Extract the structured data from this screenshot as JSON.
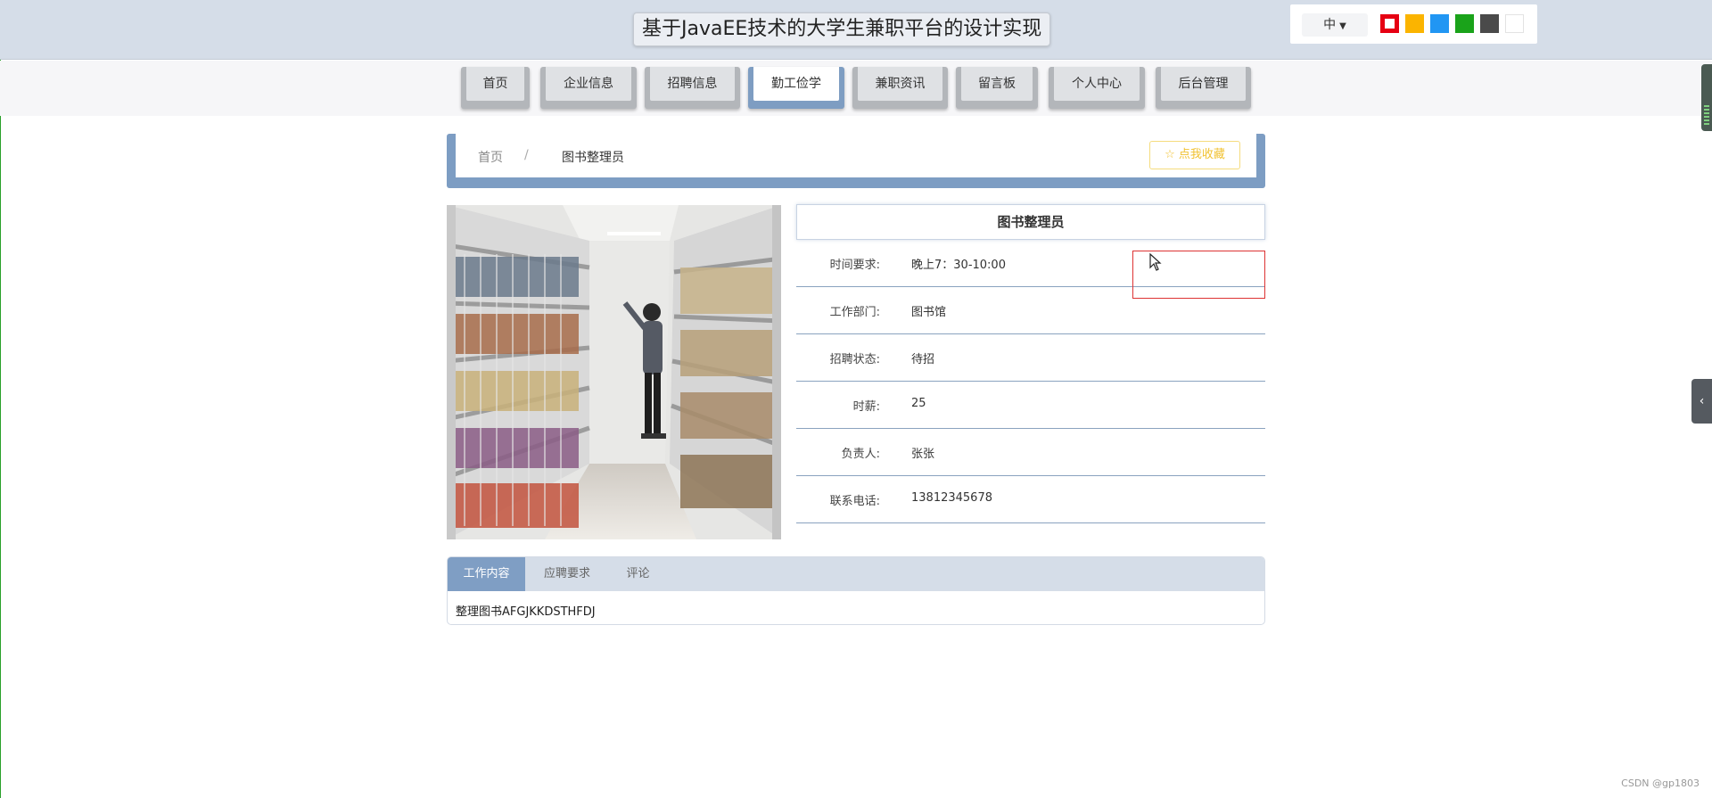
{
  "header": {
    "title": "基于JavaEE技术的大学生兼职平台的设计实现",
    "lang": "中",
    "theme_colors": [
      "#e60012",
      "#fbb400",
      "#2196f3",
      "#1aa31a",
      "#4a4a4a",
      "#ffffff"
    ]
  },
  "nav": [
    {
      "label": "首页"
    },
    {
      "label": "企业信息"
    },
    {
      "label": "招聘信息"
    },
    {
      "label": "勤工俭学"
    },
    {
      "label": "兼职资讯"
    },
    {
      "label": "留言板"
    },
    {
      "label": "个人中心"
    },
    {
      "label": "后台管理"
    }
  ],
  "nav_active": "勤工俭学",
  "breadcrumb": {
    "home": "首页",
    "separator": "/",
    "current": "图书整理员"
  },
  "favorite": {
    "icon": "star-outline-icon",
    "label": "点我收藏"
  },
  "detail": {
    "title": "图书整理员",
    "rows": [
      {
        "label": "时间要求:",
        "value": "晚上7：30-10:00"
      },
      {
        "label": "工作部门:",
        "value": "图书馆"
      },
      {
        "label": "招聘状态:",
        "value": "待招"
      },
      {
        "label": "时薪:",
        "value": "25"
      },
      {
        "label": "负责人:",
        "value": "张张"
      },
      {
        "label": "联系电话:",
        "value": "13812345678"
      }
    ]
  },
  "tabs": [
    {
      "label": "工作内容"
    },
    {
      "label": "应聘要求"
    },
    {
      "label": "评论"
    }
  ],
  "tab_active": "工作内容",
  "tab_content": "整理图书AFGJKKDSTHFDJ",
  "watermark": "CSDN @gp1803",
  "colors": {
    "accent": "#7f9ec4",
    "header_bg": "#d5dde8",
    "favorite": "#f1c232"
  }
}
